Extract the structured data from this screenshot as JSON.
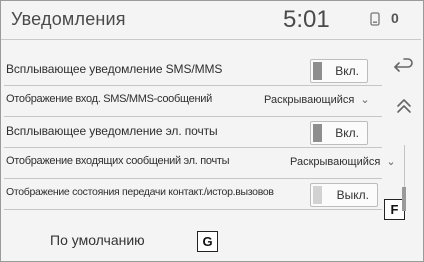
{
  "header": {
    "title": "Уведомления",
    "clock": "5:01",
    "status_count": "0"
  },
  "settings": [
    {
      "label": "Всплывающее уведомление SMS/MMS",
      "control": "toggle",
      "value": "Вкл."
    },
    {
      "label": "Отображение вход. SMS/MMS-сообщений",
      "control": "dropdown",
      "value": "Раскрывающийся"
    },
    {
      "label": "Всплывающее уведомление эл. почты",
      "control": "toggle",
      "value": "Вкл."
    },
    {
      "label": "Отображение входящих сообщений эл. почты",
      "control": "dropdown",
      "value": "Раскрывающийся"
    },
    {
      "label": "Отображение состояния передачи контакт./истор.вызовов",
      "control": "toggle",
      "value": "Выкл."
    }
  ],
  "default_button": "По умолчанию",
  "callouts": {
    "f": "F",
    "g": "G"
  },
  "icons": {
    "back": "back-arrow-icon",
    "scroll_up": "double-chevron-up-icon",
    "status": "phone-icon"
  },
  "colors": {
    "background": "#f4f4f4",
    "divider": "#c6c6c6",
    "indicator": "#8e8e8e"
  }
}
